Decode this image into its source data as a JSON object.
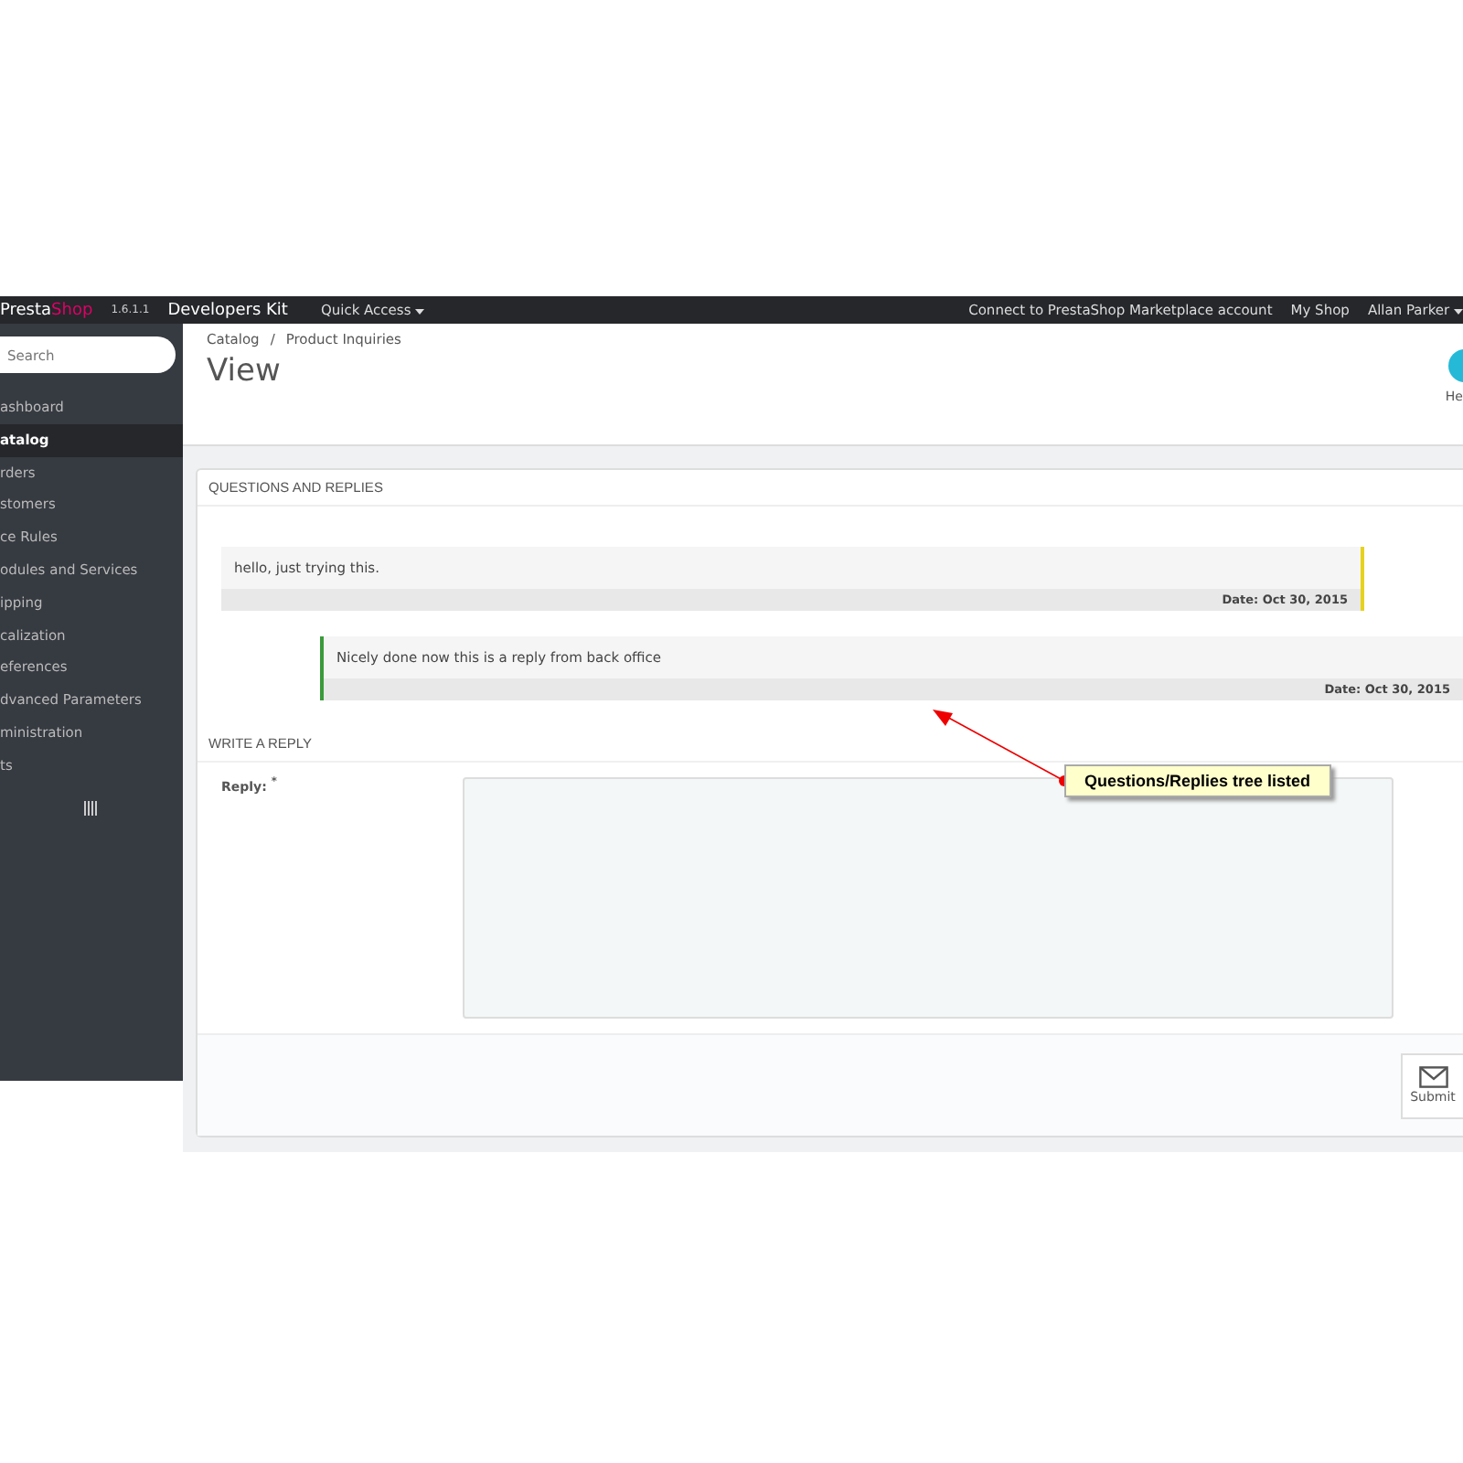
{
  "topbar": {
    "logo_left": "Presta",
    "logo_right": "Shop",
    "version": "1.6.1.1",
    "shop_name": "Developers Kit",
    "quick_access": "Quick Access",
    "connect": "Connect to PrestaShop Marketplace account",
    "my_shop": "My Shop",
    "user": "Allan Parker"
  },
  "sidebar": {
    "search": {
      "placeholder": "Search"
    },
    "items": [
      {
        "label": "ashboard",
        "selected": false
      },
      {
        "label": "atalog",
        "selected": true
      },
      {
        "label": "rders",
        "selected": false
      },
      {
        "label": "stomers",
        "selected": false
      },
      {
        "label": "ce Rules",
        "selected": false
      },
      {
        "label": "odules and Services",
        "selected": false
      },
      {
        "label": "ipping",
        "selected": false
      },
      {
        "label": "calization",
        "selected": false
      },
      {
        "label": "eferences",
        "selected": false
      },
      {
        "label": "dvanced Parameters",
        "selected": false
      },
      {
        "label": "ministration",
        "selected": false
      },
      {
        "label": "ts",
        "selected": false
      }
    ]
  },
  "header": {
    "breadcrumb": [
      "Catalog",
      "Product Inquiries"
    ],
    "breadcrumb_separator": "/",
    "title": "View",
    "help": "He"
  },
  "panel": {
    "title": "QUESTIONS AND REPLIES",
    "messages": [
      {
        "kind": "question",
        "text": "hello, just trying this.",
        "date": "Date: Oct 30, 2015",
        "color": "#e6d21c"
      },
      {
        "kind": "reply",
        "text": "Nicely done now this is a reply from back office",
        "date": "Date: Oct 30, 2015",
        "color": "#3a9a3a"
      }
    ],
    "reply_title": "WRITE A REPLY",
    "reply_label": "Reply:",
    "required_mark": "*",
    "submit": "Submit"
  },
  "annotation": {
    "text": "Questions/Replies tree listed"
  }
}
